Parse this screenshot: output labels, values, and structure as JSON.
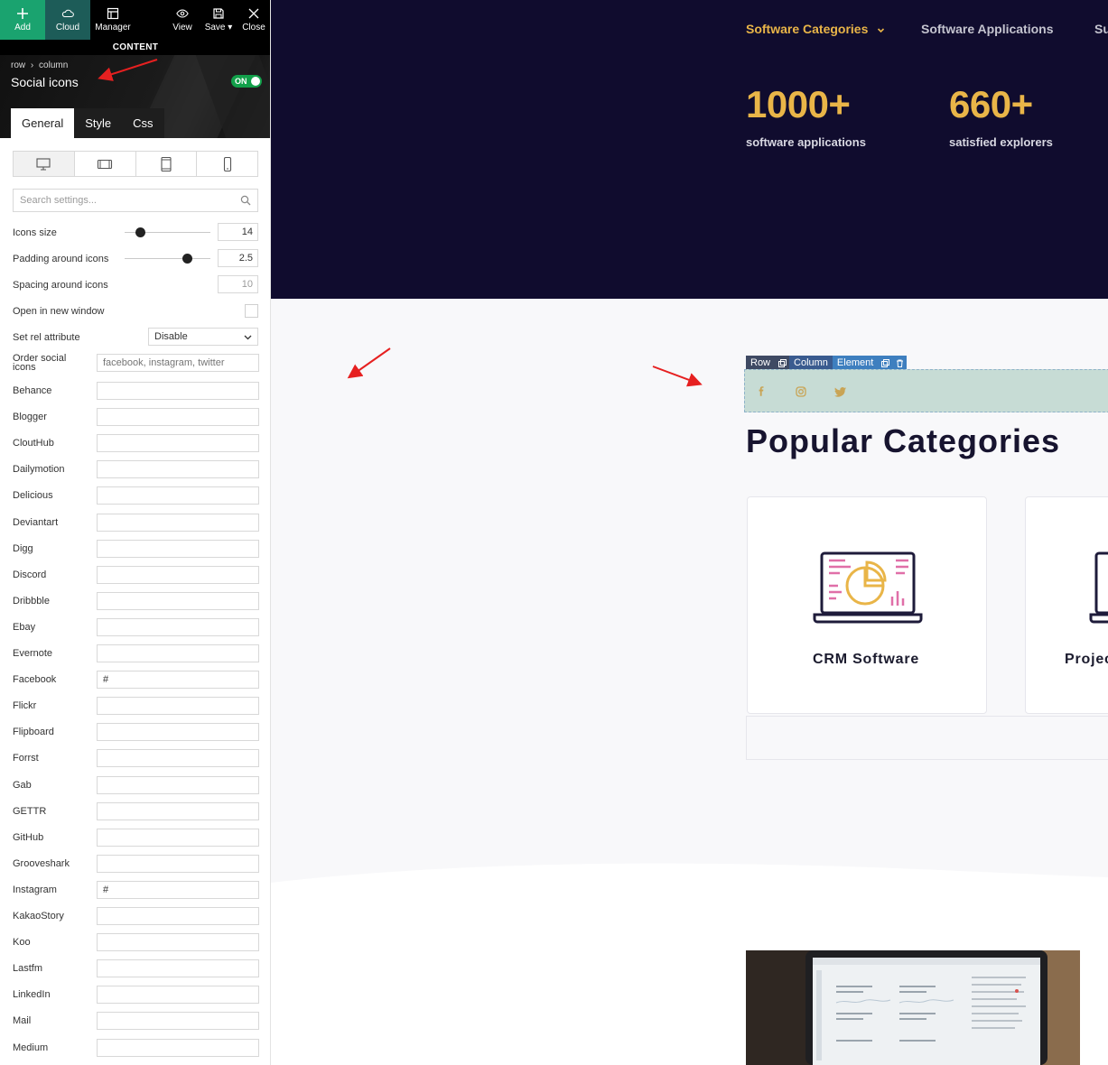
{
  "toolbar": {
    "add_label": "Add",
    "cloud_label": "Cloud",
    "manager_label": "Manager",
    "view_label": "View",
    "save_label": "Save",
    "close_label": "Close"
  },
  "panel": {
    "section_label": "CONTENT",
    "breadcrumb_row": "row",
    "breadcrumb_sep": "›",
    "breadcrumb_column": "column",
    "element_title": "Social icons",
    "toggle_label": "ON",
    "tabs": [
      {
        "label": "General",
        "active": true
      },
      {
        "label": "Style",
        "active": false
      },
      {
        "label": "Css",
        "active": false
      }
    ],
    "devices": [
      "desktop-icon",
      "tablet-landscape-icon",
      "tablet-portrait-icon",
      "mobile-icon"
    ],
    "search_placeholder": "Search settings...",
    "settings": {
      "icons_size_label": "Icons size",
      "icons_size_value": "14",
      "icons_size_level": 0.18,
      "padding_label": "Padding around icons",
      "padding_value": "2.5",
      "padding_level": 0.73,
      "spacing_label": "Spacing around icons",
      "spacing_value": "10",
      "new_window_label": "Open in new window",
      "rel_label": "Set rel attribute",
      "rel_value": "Disable",
      "order_label": "Order social icons",
      "order_placeholder": "facebook, instagram, twitter"
    },
    "networks": [
      {
        "label": "Behance",
        "value": ""
      },
      {
        "label": "Blogger",
        "value": ""
      },
      {
        "label": "CloutHub",
        "value": ""
      },
      {
        "label": "Dailymotion",
        "value": ""
      },
      {
        "label": "Delicious",
        "value": ""
      },
      {
        "label": "Deviantart",
        "value": ""
      },
      {
        "label": "Digg",
        "value": ""
      },
      {
        "label": "Discord",
        "value": ""
      },
      {
        "label": "Dribbble",
        "value": ""
      },
      {
        "label": "Ebay",
        "value": ""
      },
      {
        "label": "Evernote",
        "value": ""
      },
      {
        "label": "Facebook",
        "value": "#"
      },
      {
        "label": "Flickr",
        "value": ""
      },
      {
        "label": "Flipboard",
        "value": ""
      },
      {
        "label": "Forrst",
        "value": ""
      },
      {
        "label": "Gab",
        "value": ""
      },
      {
        "label": "GETTR",
        "value": ""
      },
      {
        "label": "GitHub",
        "value": ""
      },
      {
        "label": "Grooveshark",
        "value": ""
      },
      {
        "label": "Instagram",
        "value": "#"
      },
      {
        "label": "KakaoStory",
        "value": ""
      },
      {
        "label": "Koo",
        "value": ""
      },
      {
        "label": "Lastfm",
        "value": ""
      },
      {
        "label": "LinkedIn",
        "value": ""
      },
      {
        "label": "Mail",
        "value": ""
      },
      {
        "label": "Medium",
        "value": ""
      }
    ]
  },
  "preview": {
    "nav": [
      "Software Categories",
      "Software Applications",
      "Su"
    ],
    "stats": [
      {
        "number": "1000+",
        "label": "software applications"
      },
      {
        "number": "660+",
        "label": "satisfied explorers"
      }
    ],
    "element_bar": {
      "row": "Row",
      "column": "Column",
      "element": "Element"
    },
    "social_icons": [
      "facebook-icon",
      "instagram-icon",
      "twitter-icon"
    ],
    "section_title": "Popular Categories",
    "cards": [
      {
        "title": "CRM Software"
      },
      {
        "title": "Projec"
      }
    ]
  },
  "colors": {
    "hero_bg": "#100c2e",
    "accent": "#e9b548",
    "add_green": "#1aa36f",
    "toggle_green": "#12a04a",
    "selection_fill": "#c7dcd5"
  }
}
